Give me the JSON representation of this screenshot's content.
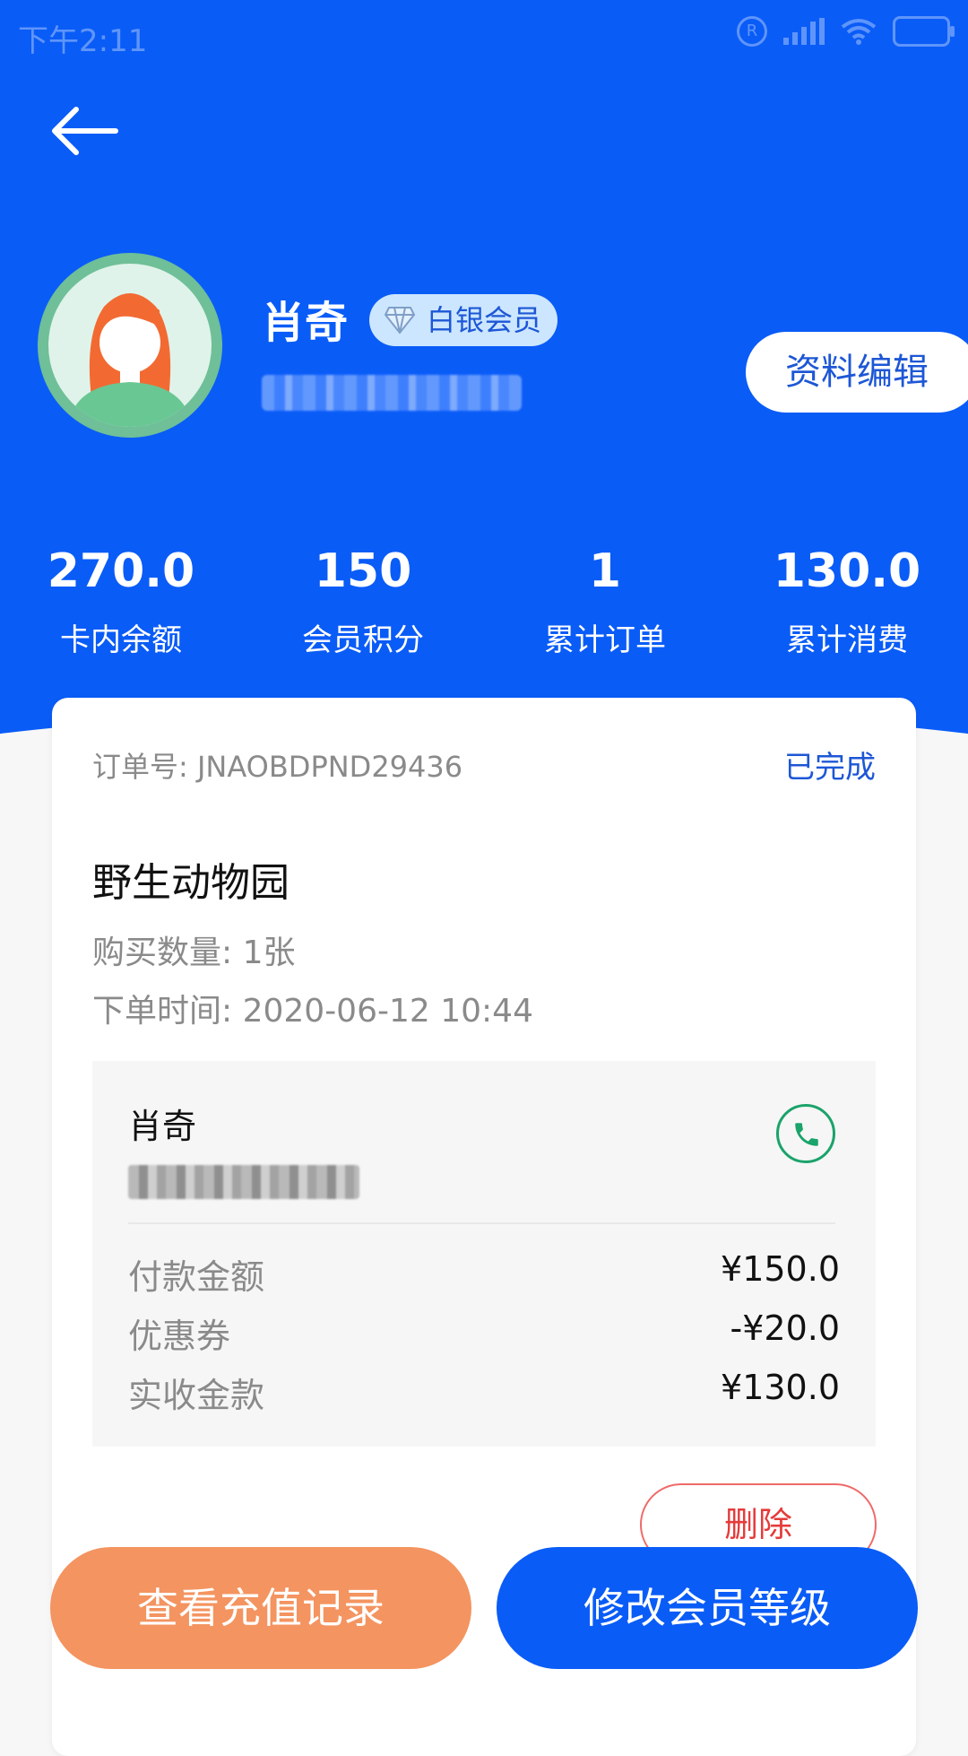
{
  "status_bar": {
    "time": "下午2:11",
    "reg_symbol": "R"
  },
  "header": {
    "back_icon": "arrow-left-icon",
    "member": {
      "name": "肖奇",
      "level_badge": "白银会员",
      "level_icon": "diamond-icon",
      "phone_masked": true
    },
    "edit_button": "资料编辑",
    "stats": [
      {
        "value": "270.0",
        "label": "卡内余额"
      },
      {
        "value": "150",
        "label": "会员积分"
      },
      {
        "value": "1",
        "label": "累计订单"
      },
      {
        "value": "130.0",
        "label": "累计消费"
      }
    ]
  },
  "order": {
    "order_no_label": "订单号: JNAOBDPND29436",
    "status": "已完成",
    "venue": "野生动物园",
    "quantity": "购买数量: 1张",
    "order_time": "下单时间: 2020-06-12 10:44",
    "contact": {
      "name": "肖奇",
      "call_icon": "phone-icon"
    },
    "payments": [
      {
        "label": "付款金额",
        "amount": "¥150.0"
      },
      {
        "label": "优惠券",
        "amount": "-¥20.0"
      },
      {
        "label": "实收金款",
        "amount": "¥130.0"
      }
    ],
    "delete_button": "删除"
  },
  "footer": {
    "recharge_button": "查看充值记录",
    "upgrade_button": "修改会员等级"
  },
  "colors": {
    "primary": "#0a5cf7",
    "accent_orange": "#f49460",
    "success_green": "#1aa36a",
    "danger_red": "#e53b3b"
  }
}
